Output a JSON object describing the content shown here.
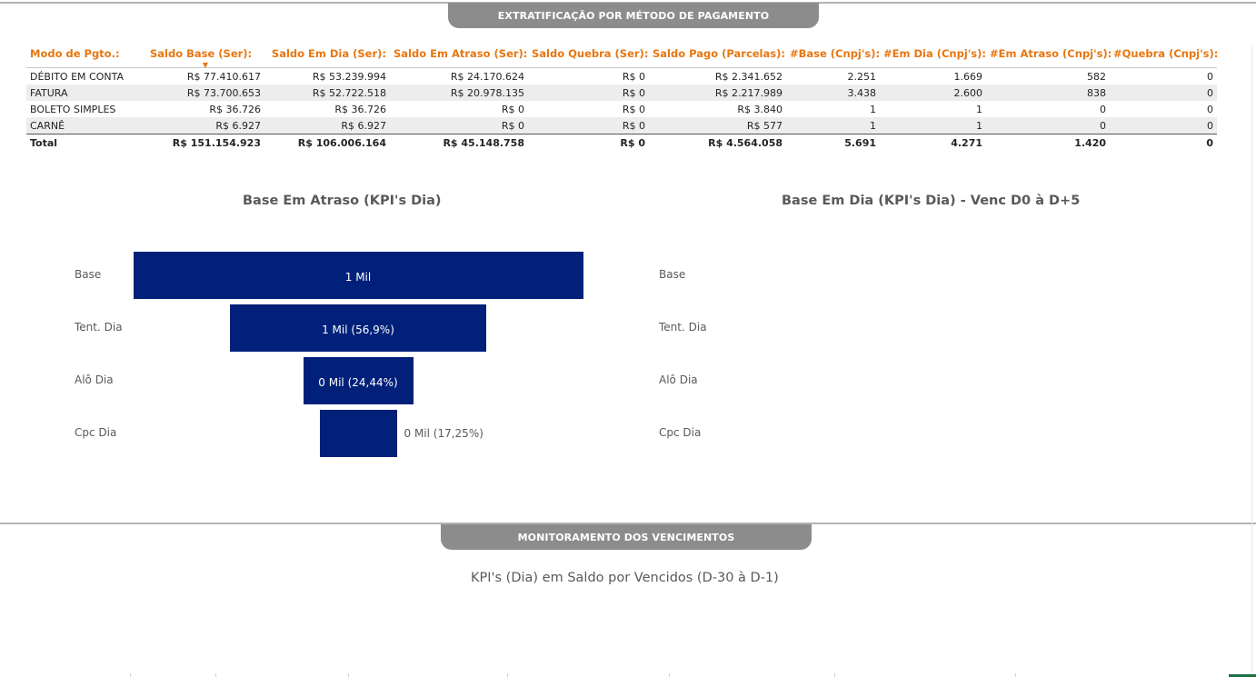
{
  "section1": {
    "title": "EXTRATIFICAÇÃO POR MÉTODO DE PAGAMENTO"
  },
  "table": {
    "headers": [
      "Modo de Pgto.:",
      "Saldo Base (Ser):",
      "Saldo Em Dia (Ser):",
      "Saldo Em Atraso (Ser):",
      "Saldo Quebra (Ser):",
      "Saldo Pago (Parcelas):",
      "#Base (Cnpj's):",
      "#Em Dia (Cnpj's):",
      "#Em Atraso (Cnpj's):",
      "#Quebra (Cnpj's):"
    ],
    "rows": [
      [
        "DÉBITO EM CONTA",
        "R$ 77.410.617",
        "R$ 53.239.994",
        "R$ 24.170.624",
        "R$ 0",
        "R$ 2.341.652",
        "2.251",
        "1.669",
        "582",
        "0"
      ],
      [
        "FATURA",
        "R$ 73.700.653",
        "R$ 52.722.518",
        "R$ 20.978.135",
        "R$ 0",
        "R$ 2.217.989",
        "3.438",
        "2.600",
        "838",
        "0"
      ],
      [
        "BOLETO SIMPLES",
        "R$ 36.726",
        "R$ 36.726",
        "R$ 0",
        "R$ 0",
        "R$ 3.840",
        "1",
        "1",
        "0",
        "0"
      ],
      [
        "CARNÊ",
        "R$ 6.927",
        "R$ 6.927",
        "R$ 0",
        "R$ 0",
        "R$ 577",
        "1",
        "1",
        "0",
        "0"
      ]
    ],
    "total": [
      "Total",
      "R$ 151.154.923",
      "R$ 106.006.164",
      "R$ 45.148.758",
      "R$ 0",
      "R$ 4.564.058",
      "5.691",
      "4.271",
      "1.420",
      "0"
    ],
    "sorted_column": "Saldo Base (Ser):"
  },
  "funnel_left": {
    "title": "Base Em Atraso (KPI's Dia)",
    "stages": [
      {
        "label": "Base",
        "value_label": "1 Mil",
        "fraction": 1.0
      },
      {
        "label": "Tent. Dia",
        "value_label": "1 Mil (56,9%)",
        "fraction": 0.569
      },
      {
        "label": "Alô Dia",
        "value_label": "0 Mil (24,44%)",
        "fraction": 0.2444
      },
      {
        "label": "Cpc Dia",
        "value_label": "0 Mil (17,25%)",
        "fraction": 0.1725
      }
    ],
    "bar_color": "#00207a"
  },
  "funnel_right": {
    "title": "Base Em Dia (KPI's Dia) - Venc D0 à D+5",
    "stages": [
      {
        "label": "Base"
      },
      {
        "label": "Tent. Dia"
      },
      {
        "label": "Alô Dia"
      },
      {
        "label": "Cpc Dia"
      }
    ]
  },
  "section2": {
    "title": "MONITORAMENTO DOS VENCIMENTOS",
    "chart_title": "KPI's (Dia) em Saldo por Vencidos (D-30 à D-1)"
  },
  "colors": {
    "header_orange": "#e8760f",
    "tab_gray": "#8c8c8c",
    "bar_navy": "#00207a"
  }
}
